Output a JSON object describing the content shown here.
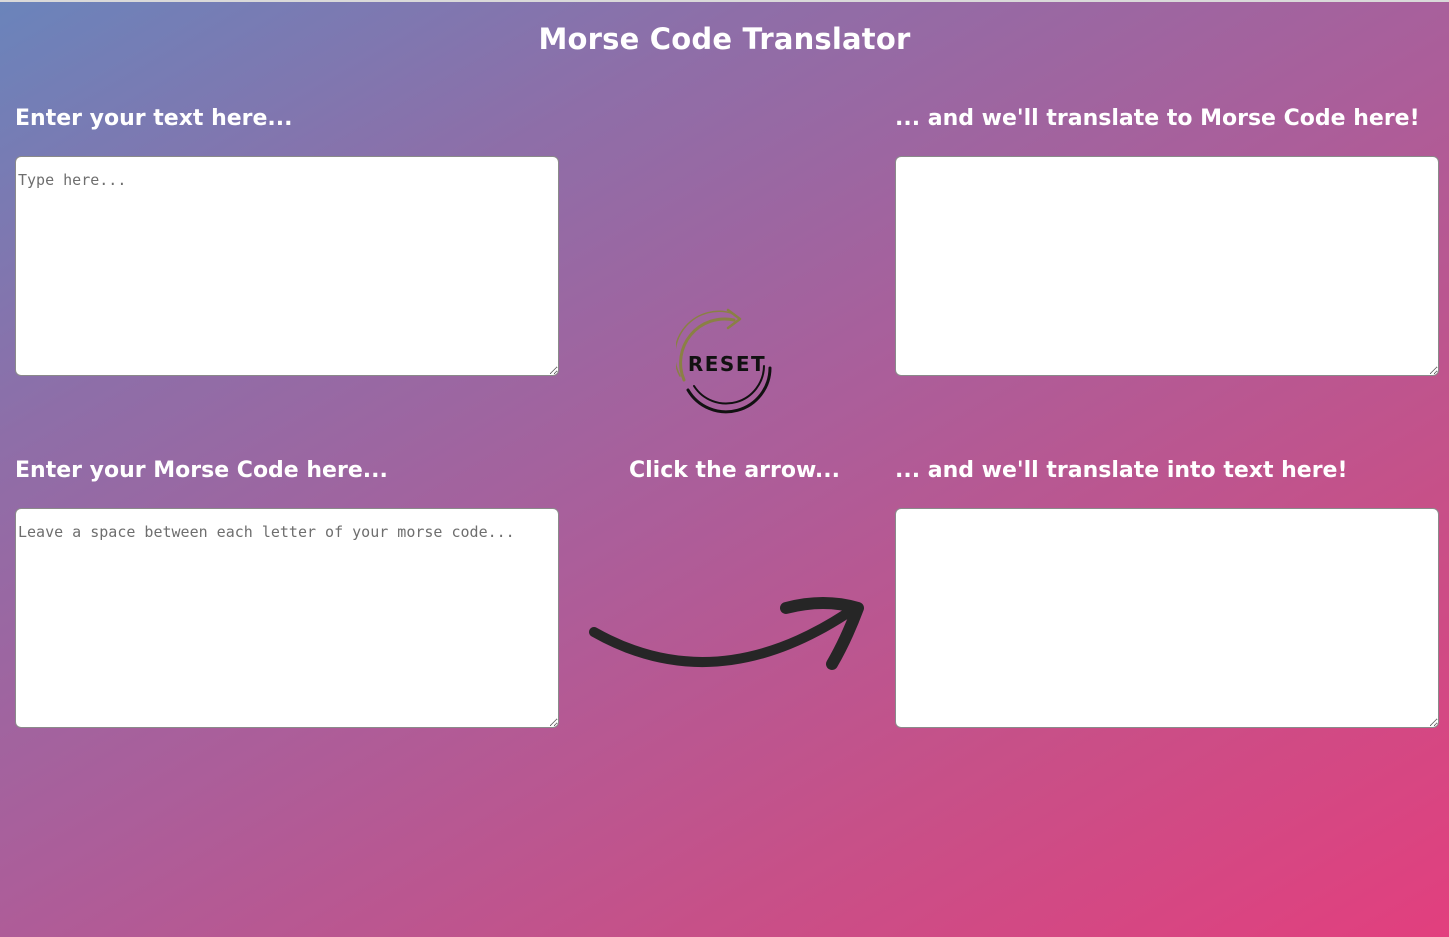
{
  "page": {
    "title": "Morse Code Translator"
  },
  "text_to_morse": {
    "input_label": "Enter your text here...",
    "input_placeholder": "Type here...",
    "input_value": "",
    "output_label": "... and we'll translate to Morse Code here!",
    "output_value": ""
  },
  "morse_to_text": {
    "input_label": "Enter your Morse Code here...",
    "input_placeholder": "Leave a space between each letter of your morse code...",
    "input_value": "",
    "output_label": "... and we'll translate into text here!",
    "output_value": ""
  },
  "controls": {
    "reset_label": "RESET",
    "arrow_hint": "Click the arrow..."
  },
  "icons": {
    "reset": "reset-circular-arrow-icon",
    "translate": "curved-arrow-right-icon"
  },
  "colors": {
    "gradient_start": "#6a84bb",
    "gradient_end": "#e23f7e",
    "reset_arrow": "#8a8044"
  }
}
